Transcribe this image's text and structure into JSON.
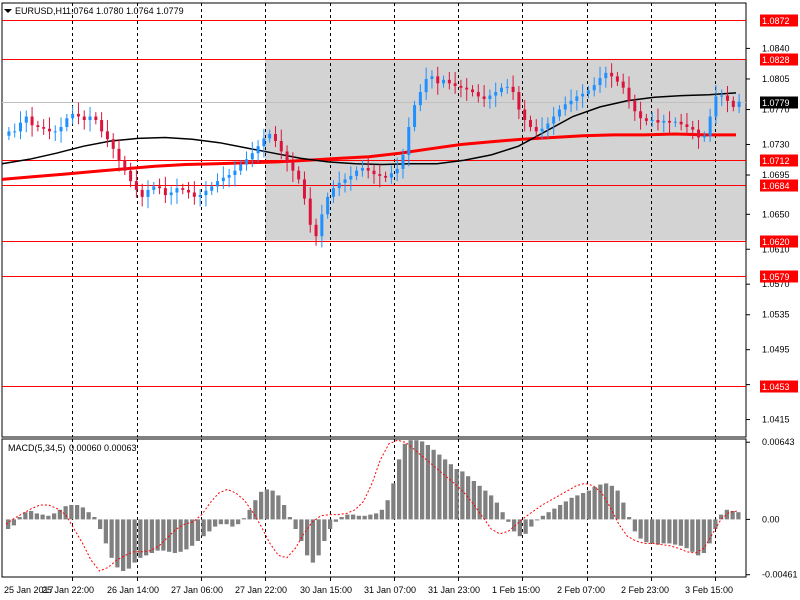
{
  "header": {
    "symbol_label": "EURUSD,H1",
    "ohlc_values": "1.0764 1.0780 1.0764 1.0779"
  },
  "colors": {
    "background": "#ffffff",
    "grid": "#000000",
    "bull_candle": "#1e90ff",
    "bear_candle": "#dc143c",
    "zone_fill": "#d3d3d3",
    "level_line": "#ff0000",
    "level_badge": "#ff0000",
    "ma_fast": "#000000",
    "ma_slow": "#ff0000",
    "macd_hist": "#808080",
    "macd_signal": "#ff0000",
    "price_badge": "#000000"
  },
  "chart_data": [
    {
      "type": "candlestick",
      "title": "EURUSD,H1",
      "ylim": [
        1.0395,
        1.0892
      ],
      "y_ticks": [
        "1.0840",
        "1.0805",
        "1.0770",
        "1.0730",
        "1.0695",
        "1.0650",
        "1.0610",
        "1.0570",
        "1.0535",
        "1.0495",
        "1.0455",
        "1.0415"
      ],
      "x_tick_labels": [
        "25 Jan 2017",
        "25 Jan 22:00",
        "26 Jan 14:00",
        "27 Jan 06:00",
        "27 Jan 22:00",
        "30 Jan 15:00",
        "31 Jan 07:00",
        "31 Jan 23:00",
        "1 Feb 15:00",
        "2 Feb 07:00",
        "2 Feb 23:00",
        "3 Feb 15:00"
      ],
      "current_price": "1.0779",
      "horizontal_levels": [
        "1.0872",
        "1.0828",
        "1.0712",
        "1.0684",
        "1.0620",
        "1.0579",
        "1.0453"
      ],
      "zone": {
        "from_label": "27 Jan 22:00",
        "to_label": "3 Feb 15:00",
        "top": 1.0828,
        "bottom": 1.062
      },
      "series": [
        {
          "name": "candles",
          "values": [
            1.0745,
            1.0745,
            1.0755,
            1.0762,
            1.0752,
            1.075,
            1.0748,
            1.0745,
            1.0745,
            1.075,
            1.076,
            1.0765,
            1.0762,
            1.0758,
            1.0762,
            1.0758,
            1.0745,
            1.0736,
            1.0725,
            1.0712,
            1.07,
            1.0688,
            1.0678,
            1.067,
            1.0678,
            1.0682,
            1.068,
            1.0672,
            1.0675,
            1.068,
            1.0678,
            1.0675,
            1.067,
            1.0672,
            1.0677,
            1.0682,
            1.0688,
            1.0692,
            1.0695,
            1.07,
            1.0707,
            1.0713,
            1.072,
            1.0728,
            1.0737,
            1.0742,
            1.0734,
            1.0722,
            1.071,
            1.07,
            1.069,
            1.0668,
            1.0638,
            1.0625,
            1.065,
            1.067,
            1.068,
            1.0686,
            1.069,
            1.0694,
            1.07,
            1.0703,
            1.07,
            1.0696,
            1.0694,
            1.0692,
            1.0697,
            1.0702,
            1.0718,
            1.075,
            1.0775,
            1.079,
            1.0805,
            1.0808,
            1.08,
            1.0804,
            1.08,
            1.0797,
            1.0795,
            1.0793,
            1.079,
            1.0785,
            1.0782,
            1.0786,
            1.079,
            1.0795,
            1.0796,
            1.079,
            1.077,
            1.0758,
            1.075,
            1.0745,
            1.0748,
            1.0754,
            1.0762,
            1.077,
            1.0776,
            1.078,
            1.0785,
            1.0788,
            1.0792,
            1.0798,
            1.0806,
            1.0812,
            1.0808,
            1.0802,
            1.0795,
            1.078,
            1.0768,
            1.076,
            1.0757,
            1.0758,
            1.0755,
            1.0757,
            1.0755,
            1.0756,
            1.0753,
            1.075,
            1.0747,
            1.0738,
            1.074,
            1.0762,
            1.0785,
            1.0786,
            1.078,
            1.0773,
            1.0779
          ]
        },
        {
          "name": "MA fast",
          "values": [
            1.0708,
            1.0713,
            1.072,
            1.0728,
            1.0734,
            1.0737,
            1.0738,
            1.0736,
            1.0732,
            1.0726,
            1.072,
            1.0714,
            1.071,
            1.0708,
            1.0707,
            1.0708,
            1.0708,
            1.0712,
            1.0718,
            1.0728,
            1.0745,
            1.0762,
            1.0773,
            1.078,
            1.0784,
            1.0786,
            1.0787,
            1.0789
          ]
        },
        {
          "name": "MA slow",
          "values": [
            1.069,
            1.0693,
            1.0696,
            1.0699,
            1.0702,
            1.0705,
            1.0707,
            1.0708,
            1.0709,
            1.071,
            1.0712,
            1.0714,
            1.0716,
            1.072,
            1.0725,
            1.073,
            1.0733,
            1.0736,
            1.0738,
            1.074,
            1.0741,
            1.0741,
            1.0742,
            1.0741,
            1.0741
          ]
        }
      ]
    },
    {
      "type": "bar",
      "title": "MACD(5,34,5)",
      "header_values": "0.00060 0.00063",
      "ylim": [
        -0.0048,
        0.0067
      ],
      "y_ticks": [
        "0.00643",
        "0.00",
        "-0.00461"
      ],
      "series": [
        {
          "name": "histogram",
          "values": [
            -0.0008,
            -0.0005,
            0.0002,
            0.0006,
            0.0007,
            0.0005,
            0.0004,
            0.0003,
            0.0005,
            0.0008,
            0.0011,
            0.0012,
            0.0012,
            0.001,
            0.0006,
            0.0002,
            -0.0008,
            -0.002,
            -0.0032,
            -0.004,
            -0.0043,
            -0.0041,
            -0.0036,
            -0.0032,
            -0.003,
            -0.0028,
            -0.0026,
            -0.0026,
            -0.0027,
            -0.0028,
            -0.0027,
            -0.0025,
            -0.0022,
            -0.0018,
            -0.0014,
            -0.001,
            -0.0006,
            -0.0004,
            -0.0004,
            -0.0006,
            -0.0004,
            0.0001,
            0.0008,
            0.0016,
            0.0023,
            0.0025,
            0.0024,
            0.002,
            0.0012,
            0.0002,
            -0.0008,
            -0.0018,
            -0.003,
            -0.0036,
            -0.003,
            -0.0018,
            -0.0008,
            -0.0002,
            0.0002,
            0.0004,
            0.0004,
            0.0003,
            0.0003,
            0.0004,
            0.0005,
            0.0008,
            0.0016,
            0.003,
            0.005,
            0.0063,
            0.0066,
            0.0066,
            0.0065,
            0.0062,
            0.0058,
            0.0054,
            0.005,
            0.0046,
            0.0042,
            0.004,
            0.0036,
            0.0032,
            0.0028,
            0.0024,
            0.002,
            0.0014,
            0.0006,
            -0.0002,
            -0.001,
            -0.0014,
            -0.0012,
            -0.0006,
            0.0,
            0.0003,
            0.0006,
            0.0009,
            0.0012,
            0.0015,
            0.0018,
            0.002,
            0.0022,
            0.0024,
            0.0027,
            0.0029,
            0.003,
            0.0028,
            0.0024,
            0.0014,
            0.0002,
            -0.001,
            -0.0016,
            -0.0019,
            -0.002,
            -0.0021,
            -0.002,
            -0.002,
            -0.0021,
            -0.0022,
            -0.0024,
            -0.0027,
            -0.003,
            -0.0028,
            -0.002,
            -0.0008,
            0.0004,
            0.0008,
            0.0007,
            0.0006
          ]
        },
        {
          "name": "signal",
          "values": [
            -0.0004,
            0.0001,
            0.0005,
            0.0009,
            0.0012,
            0.0012,
            0.0009,
            0.0004,
            -0.0008,
            -0.002,
            -0.0034,
            -0.0043,
            -0.004,
            -0.0034,
            -0.003,
            -0.0027,
            -0.0027,
            -0.0026,
            -0.0022,
            -0.0015,
            -0.0008,
            -0.0004,
            -0.0002,
            0.0004,
            0.0014,
            0.0022,
            0.0025,
            0.0022,
            0.0016,
            0.0006,
            -0.0006,
            -0.002,
            -0.003,
            -0.0032,
            -0.0024,
            -0.0012,
            -0.0002,
            0.0003,
            0.0004,
            0.0004,
            0.0005,
            0.0008,
            0.0015,
            0.003,
            0.005,
            0.0063,
            0.0066,
            0.0064,
            0.0058,
            0.0052,
            0.0046,
            0.004,
            0.0034,
            0.0028,
            0.0021,
            0.0012,
            0.0002,
            -0.0008,
            -0.0012,
            -0.001,
            -0.0004,
            0.0002,
            0.0007,
            0.0012,
            0.0016,
            0.002,
            0.0024,
            0.0028,
            0.003,
            0.0028,
            0.0022,
            0.001,
            -0.0004,
            -0.0014,
            -0.0018,
            -0.002,
            -0.002,
            -0.0021,
            -0.0022,
            -0.0024,
            -0.0027,
            -0.0028,
            -0.0024,
            -0.0012,
            0.0,
            0.0006,
            0.0007
          ]
        }
      ]
    }
  ]
}
